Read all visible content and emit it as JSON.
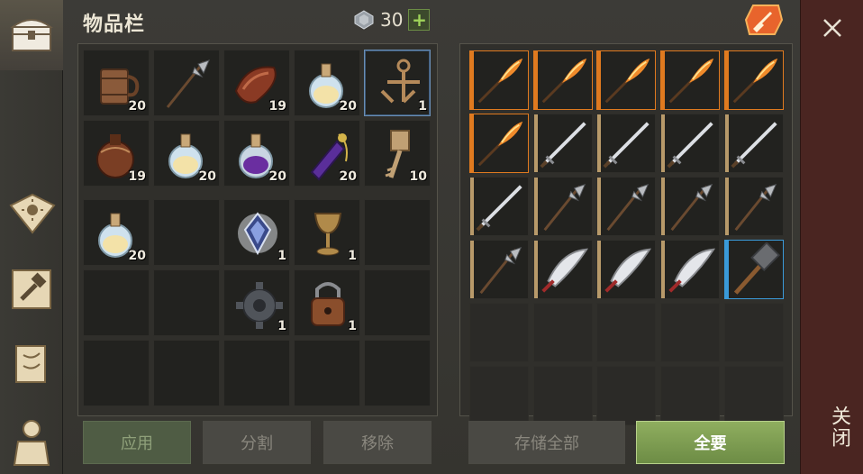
{
  "header": {
    "title": "物品栏",
    "gem_count": "30",
    "plus_label": "+"
  },
  "inventory": {
    "slots": [
      {
        "icon": "wooden-mug-icon",
        "count": "20"
      },
      {
        "icon": "halberd-icon",
        "count": ""
      },
      {
        "icon": "meat-strip-icon",
        "count": "19"
      },
      {
        "icon": "white-potion-icon",
        "count": "20"
      },
      {
        "icon": "cross-key-icon",
        "count": "1",
        "selected": true
      },
      {
        "icon": "leather-flask-icon",
        "count": "19"
      },
      {
        "icon": "white-potion-icon",
        "count": "20"
      },
      {
        "icon": "purple-potion-icon",
        "count": "20"
      },
      {
        "icon": "purple-bottle-icon",
        "count": "20"
      },
      {
        "icon": "ornate-key-icon",
        "count": "10"
      },
      {
        "icon": "white-potion-icon",
        "count": "20"
      },
      {
        "icon": "empty",
        "count": ""
      },
      {
        "icon": "crystal-icon",
        "count": "1"
      },
      {
        "icon": "goblet-icon",
        "count": "1"
      },
      {
        "icon": "empty",
        "count": ""
      },
      {
        "icon": "empty",
        "count": ""
      },
      {
        "icon": "empty",
        "count": ""
      },
      {
        "icon": "gear-icon",
        "count": "1"
      },
      {
        "icon": "padlock-icon",
        "count": "1"
      },
      {
        "icon": "empty",
        "count": ""
      },
      {
        "icon": "empty",
        "count": ""
      },
      {
        "icon": "empty",
        "count": ""
      },
      {
        "icon": "empty",
        "count": ""
      },
      {
        "icon": "empty",
        "count": ""
      },
      {
        "icon": "empty",
        "count": ""
      }
    ]
  },
  "storage": {
    "slots": [
      {
        "icon": "fire-spear-icon",
        "rarity": "orange"
      },
      {
        "icon": "fire-spear-icon",
        "rarity": "orange"
      },
      {
        "icon": "fire-spear-icon",
        "rarity": "orange"
      },
      {
        "icon": "fire-spear-icon",
        "rarity": "orange"
      },
      {
        "icon": "fire-spear-icon",
        "rarity": "orange"
      },
      {
        "icon": "fire-spear-icon",
        "rarity": "orange"
      },
      {
        "icon": "long-sword-icon",
        "rarity": "tan"
      },
      {
        "icon": "long-sword-icon",
        "rarity": "tan"
      },
      {
        "icon": "long-sword-icon",
        "rarity": "tan"
      },
      {
        "icon": "long-sword-icon",
        "rarity": "tan"
      },
      {
        "icon": "long-sword-icon",
        "rarity": "tan"
      },
      {
        "icon": "halberd-icon",
        "rarity": "tan"
      },
      {
        "icon": "halberd-icon",
        "rarity": "tan"
      },
      {
        "icon": "halberd-icon",
        "rarity": "tan"
      },
      {
        "icon": "halberd-icon",
        "rarity": "tan"
      },
      {
        "icon": "halberd-icon",
        "rarity": "tan"
      },
      {
        "icon": "scimitar-icon",
        "rarity": "tan"
      },
      {
        "icon": "scimitar-icon",
        "rarity": "tan"
      },
      {
        "icon": "scimitar-icon",
        "rarity": "tan"
      },
      {
        "icon": "sledgehammer-icon",
        "rarity": "blue"
      },
      {
        "icon": "empty"
      },
      {
        "icon": "empty"
      },
      {
        "icon": "empty"
      },
      {
        "icon": "empty"
      },
      {
        "icon": "empty"
      },
      {
        "icon": "empty"
      },
      {
        "icon": "empty"
      },
      {
        "icon": "empty"
      },
      {
        "icon": "empty"
      },
      {
        "icon": "empty"
      }
    ]
  },
  "buttons": {
    "apply": "应用",
    "split": "分割",
    "remove": "移除",
    "store_all": "存储全部",
    "take_all": "全要",
    "close": "关闭"
  },
  "colors": {
    "rarity_orange": "#e07a1f",
    "rarity_tan": "#b89a6a",
    "rarity_blue": "#3a9ad9",
    "accent_green": "#7f9e52",
    "close_bg": "#4a2521"
  },
  "rail": {
    "icons": [
      "chest-icon",
      "sun-book-icon",
      "crafting-hammer-icon",
      "scroll-map-icon",
      "character-icon"
    ]
  }
}
